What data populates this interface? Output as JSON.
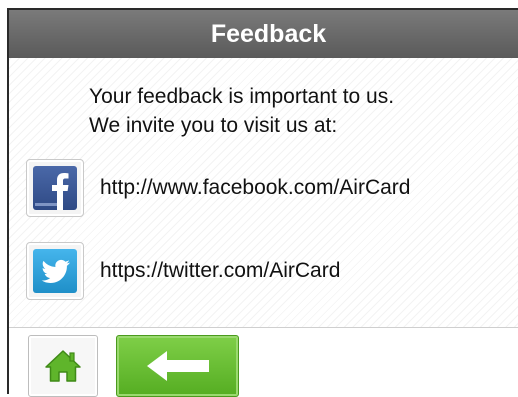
{
  "header": {
    "title": "Feedback"
  },
  "intro": {
    "line1": "Your feedback is important to us.",
    "line2": "We invite you to visit us at:"
  },
  "links": [
    {
      "icon": "facebook-icon",
      "text": "http://www.facebook.com/AirCard",
      "color": "#3b5998"
    },
    {
      "icon": "twitter-icon",
      "text": "https://twitter.com/AirCard",
      "color": "#2a9fd6"
    }
  ],
  "toolbar": {
    "home_icon": "home-icon",
    "back_icon": "back-arrow-icon",
    "accent": "#5cb82b"
  }
}
